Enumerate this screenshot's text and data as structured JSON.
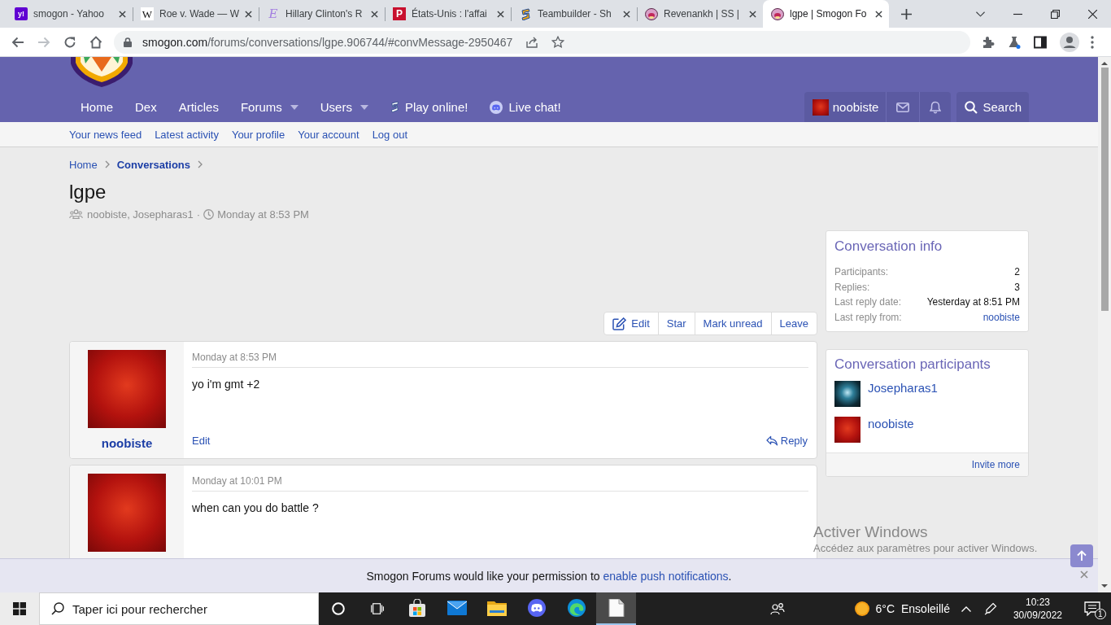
{
  "browser": {
    "tabs": [
      {
        "title": "smogon - Yahoo",
        "kind": "yahoo",
        "glyph": "y!",
        "selected": false
      },
      {
        "title": "Roe v. Wade — W",
        "kind": "wiki",
        "glyph": "W",
        "selected": false
      },
      {
        "title": "Hillary Clinton's R",
        "kind": "script",
        "glyph": "E",
        "selected": false
      },
      {
        "title": "États-Unis : l'affai",
        "kind": "news",
        "glyph": "P",
        "selected": false
      },
      {
        "title": "Teambuilder - Sh",
        "kind": "showdown",
        "selected": false
      },
      {
        "title": "Revenankh | SS |",
        "kind": "smogon",
        "selected": false
      },
      {
        "title": "lgpe | Smogon Fo",
        "kind": "smogon",
        "selected": true
      }
    ],
    "nav_buttons": [
      {
        "kind": "back",
        "disabled": false
      },
      {
        "kind": "forward",
        "disabled": true
      },
      {
        "kind": "reload",
        "disabled": false
      },
      {
        "kind": "home",
        "disabled": false
      }
    ],
    "address": {
      "host": "smogon.com",
      "path": "/forums/conversations/lgpe.906744/#convMessage-2950467"
    }
  },
  "site": {
    "nav": [
      {
        "label": "Home",
        "kind": "plain"
      },
      {
        "label": "Dex",
        "kind": "plain"
      },
      {
        "label": "Articles",
        "kind": "plain"
      },
      {
        "label": "Forums",
        "kind": "menu"
      },
      {
        "label": "Users",
        "kind": "menu"
      },
      {
        "label": "Play online!",
        "kind": "showdown"
      },
      {
        "label": "Live chat!",
        "kind": "discord"
      }
    ],
    "user": "noobiste",
    "search": "Search",
    "subnav": [
      "Your news feed",
      "Latest activity",
      "Your profile",
      "Your account",
      "Log out"
    ]
  },
  "page": {
    "breadcrumb": [
      {
        "label": "Home",
        "selected": false
      },
      {
        "label": "Conversations",
        "selected": true
      }
    ],
    "title": "lgpe",
    "participants": "noobiste, Josepharas1",
    "separator": "·",
    "date": "Monday at 8:53 PM",
    "actions": [
      {
        "label": "Edit",
        "kind": "edit"
      },
      {
        "label": "Star",
        "kind": "plain"
      },
      {
        "label": "Mark unread",
        "kind": "plain"
      },
      {
        "label": "Leave",
        "kind": "plain"
      }
    ],
    "messages": [
      {
        "author": "noobiste",
        "date": "Monday at 8:53 PM",
        "text": "yo i'm gmt +2",
        "edit": "Edit",
        "reply": "Reply"
      },
      {
        "date": "Monday at 10:01 PM",
        "text": "when can you do battle ?"
      }
    ]
  },
  "sidebar": {
    "info": {
      "title": "Conversation info",
      "rows": [
        {
          "label": "Participants:",
          "value": "2",
          "kind": "text"
        },
        {
          "label": "Replies:",
          "value": "3",
          "kind": "text"
        },
        {
          "label": "Last reply date:",
          "value": "Yesterday at 8:51 PM",
          "kind": "text"
        },
        {
          "label": "Last reply from:",
          "value": "noobiste",
          "kind": "link"
        }
      ]
    },
    "participants": {
      "title": "Conversation participants",
      "people": [
        {
          "name": "Josepharas1",
          "kind": "fist"
        },
        {
          "name": "noobiste",
          "kind": "red"
        }
      ],
      "footer": "Invite more"
    }
  },
  "notice": {
    "before": "Smogon Forums would like your permission to",
    "link": "enable push notifications",
    "after": "."
  },
  "os_notice": {
    "title": "Activer Windows",
    "subtitle": "Accédez aux paramètres pour activer Windows."
  },
  "taskbar": {
    "search": {
      "placeholder": "Taper ici pour rechercher"
    },
    "apps": [
      {
        "kind": "store",
        "selected": false
      },
      {
        "kind": "mail",
        "selected": false
      },
      {
        "kind": "folder",
        "selected": false
      },
      {
        "kind": "discord",
        "selected": false
      },
      {
        "kind": "edge",
        "selected": false
      },
      {
        "kind": "file",
        "selected": true
      }
    ],
    "weather": {
      "temperature": "6°C",
      "condition": "Ensoleillé"
    },
    "time": "10:23",
    "date": "30/09/2022",
    "notifications": "1"
  }
}
